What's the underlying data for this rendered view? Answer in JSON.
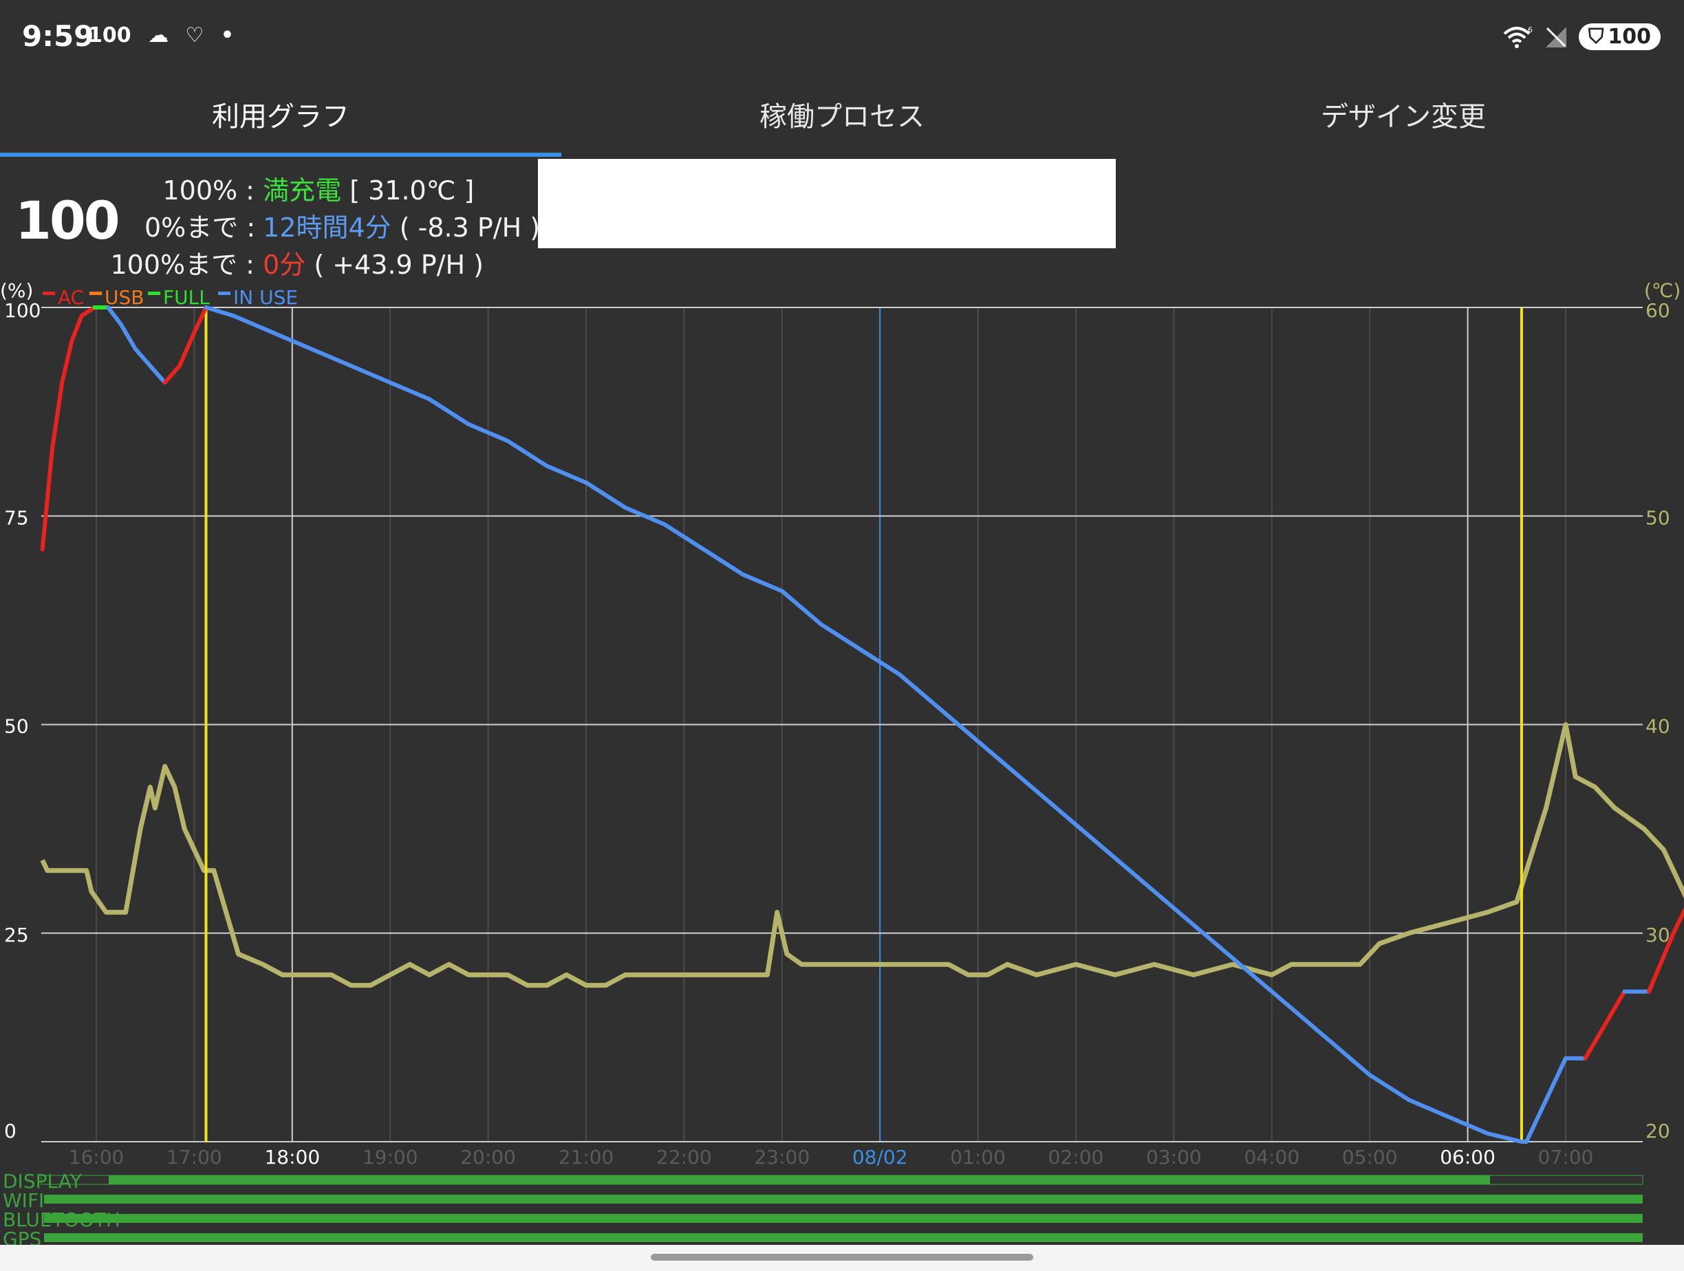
{
  "status_bar": {
    "time": "9:59",
    "left_icons": [
      {
        "name": "battery-saver-100-icon",
        "text": "100"
      },
      {
        "name": "cloud-icon",
        "text": "☁"
      },
      {
        "name": "health-icon",
        "text": "♡"
      },
      {
        "name": "dot-icon",
        "text": "•"
      }
    ],
    "right_icons": [
      "wifi-6-icon",
      "no-signal-icon"
    ],
    "battery": "100"
  },
  "tabs": [
    {
      "label": "利用グラフ",
      "active": true
    },
    {
      "label": "稼働プロセス",
      "active": false
    },
    {
      "label": "デザイン変更",
      "active": false
    }
  ],
  "info": {
    "level": "100",
    "row1": {
      "key": "100% :",
      "value": "満充電",
      "extra": "[ 31.0℃ ]"
    },
    "row2": {
      "key": "0%まで :",
      "value": "12時間4分",
      "extra": "( -8.3 P/H )"
    },
    "row3": {
      "key": "100%まで :",
      "value": "0分",
      "extra": "( +43.9 P/H )"
    }
  },
  "colors": {
    "ac": "#e8231d",
    "usb": "#f07a1f",
    "full": "#2ee02e",
    "in_use": "#4f8ff0",
    "temperature": "#b5b46a",
    "plug_marker": "#f3e21a",
    "accent": "#3b8fe6"
  },
  "chart_data": {
    "type": "line",
    "left_unit": "(%)",
    "right_unit": "(℃)",
    "left_ticks": [
      "100",
      "75",
      "50",
      "25",
      "0"
    ],
    "right_ticks": [
      "60",
      "50",
      "40",
      "30",
      "20"
    ],
    "ylim_left": [
      0,
      100
    ],
    "ylim_right": [
      20,
      60
    ],
    "x_tick_labels": [
      "16:00",
      "17:00",
      "18:00",
      "19:00",
      "20:00",
      "21:00",
      "22:00",
      "23:00",
      "08/02",
      "01:00",
      "02:00",
      "03:00",
      "04:00",
      "05:00",
      "06:00",
      "07:00"
    ],
    "legend": [
      {
        "name": "AC",
        "color": "#e8231d"
      },
      {
        "name": "USB",
        "color": "#f07a1f"
      },
      {
        "name": "FULL",
        "color": "#2ee02e"
      },
      {
        "name": "IN USE",
        "color": "#4f8ff0"
      }
    ],
    "battery_segments": [
      {
        "state": "AC",
        "points": [
          [
            15.45,
            71
          ],
          [
            15.55,
            83
          ],
          [
            15.65,
            91
          ],
          [
            15.75,
            96
          ],
          [
            15.85,
            99
          ],
          [
            15.98,
            100
          ]
        ]
      },
      {
        "state": "FULL",
        "points": [
          [
            15.98,
            100
          ],
          [
            16.12,
            100
          ]
        ]
      },
      {
        "state": "IN USE",
        "points": [
          [
            16.12,
            100
          ],
          [
            16.25,
            98
          ],
          [
            16.4,
            95
          ],
          [
            16.55,
            93
          ],
          [
            16.7,
            91
          ]
        ]
      },
      {
        "state": "AC",
        "points": [
          [
            16.7,
            91
          ],
          [
            16.85,
            93
          ],
          [
            17.0,
            97
          ],
          [
            17.12,
            100
          ]
        ]
      },
      {
        "state": "IN USE",
        "points": [
          [
            17.12,
            100
          ],
          [
            17.4,
            99
          ],
          [
            17.8,
            97
          ],
          [
            18.2,
            95
          ],
          [
            18.6,
            93
          ],
          [
            19.0,
            91
          ],
          [
            19.4,
            89
          ],
          [
            19.8,
            86
          ],
          [
            20.2,
            84
          ],
          [
            20.6,
            81
          ],
          [
            21.0,
            79
          ],
          [
            21.4,
            76
          ],
          [
            21.8,
            74
          ],
          [
            22.2,
            71
          ],
          [
            22.6,
            68
          ],
          [
            23.0,
            66
          ],
          [
            23.4,
            62
          ],
          [
            23.8,
            59
          ],
          [
            24.2,
            56
          ],
          [
            24.6,
            52
          ],
          [
            25.0,
            48
          ],
          [
            25.4,
            44
          ],
          [
            25.8,
            40
          ],
          [
            26.2,
            36
          ],
          [
            26.6,
            32
          ],
          [
            27.0,
            28
          ],
          [
            27.4,
            24
          ],
          [
            27.8,
            20
          ],
          [
            28.2,
            16
          ],
          [
            28.6,
            12
          ],
          [
            29.0,
            8
          ],
          [
            29.4,
            5
          ],
          [
            29.8,
            3
          ],
          [
            30.2,
            1
          ],
          [
            30.55,
            0
          ],
          [
            30.6,
            0
          ],
          [
            30.8,
            5
          ],
          [
            31.0,
            10
          ],
          [
            31.2,
            10
          ]
        ]
      },
      {
        "state": "AC",
        "points": [
          [
            31.2,
            10
          ],
          [
            31.6,
            18
          ]
        ]
      },
      {
        "state": "IN USE",
        "points": [
          [
            31.6,
            18
          ],
          [
            31.85,
            18
          ]
        ]
      },
      {
        "state": "AC",
        "points": [
          [
            31.85,
            18
          ],
          [
            32.1,
            25
          ],
          [
            32.35,
            31
          ],
          [
            32.6,
            38
          ],
          [
            32.8,
            46
          ],
          [
            32.95,
            54
          ]
        ]
      }
    ],
    "temperature_series": {
      "name": "Temperature",
      "points": [
        [
          15.45,
          33.5
        ],
        [
          15.5,
          33
        ],
        [
          15.9,
          33
        ],
        [
          15.95,
          32
        ],
        [
          16.1,
          31
        ],
        [
          16.3,
          31
        ],
        [
          16.45,
          35
        ],
        [
          16.55,
          37
        ],
        [
          16.6,
          36
        ],
        [
          16.7,
          38
        ],
        [
          16.8,
          37
        ],
        [
          16.9,
          35
        ],
        [
          17.0,
          34
        ],
        [
          17.1,
          33
        ],
        [
          17.2,
          33
        ],
        [
          17.45,
          29
        ],
        [
          17.7,
          28.5
        ],
        [
          17.9,
          28
        ],
        [
          18.2,
          28
        ],
        [
          18.4,
          28
        ],
        [
          18.6,
          27.5
        ],
        [
          18.8,
          27.5
        ],
        [
          19.0,
          28
        ],
        [
          19.2,
          28.5
        ],
        [
          19.4,
          28
        ],
        [
          19.6,
          28.5
        ],
        [
          19.8,
          28
        ],
        [
          20.0,
          28
        ],
        [
          20.2,
          28
        ],
        [
          20.4,
          27.5
        ],
        [
          20.6,
          27.5
        ],
        [
          20.8,
          28
        ],
        [
          21.0,
          27.5
        ],
        [
          21.2,
          27.5
        ],
        [
          21.4,
          28
        ],
        [
          21.8,
          28
        ],
        [
          22.2,
          28
        ],
        [
          22.6,
          28
        ],
        [
          22.85,
          28
        ],
        [
          22.95,
          31
        ],
        [
          23.05,
          29
        ],
        [
          23.2,
          28.5
        ],
        [
          23.6,
          28.5
        ],
        [
          24.0,
          28.5
        ],
        [
          24.4,
          28.5
        ],
        [
          24.7,
          28.5
        ],
        [
          24.9,
          28
        ],
        [
          25.1,
          28
        ],
        [
          25.3,
          28.5
        ],
        [
          25.6,
          28
        ],
        [
          26.0,
          28.5
        ],
        [
          26.4,
          28
        ],
        [
          26.8,
          28.5
        ],
        [
          27.2,
          28
        ],
        [
          27.6,
          28.5
        ],
        [
          28.0,
          28
        ],
        [
          28.2,
          28.5
        ],
        [
          28.6,
          28.5
        ],
        [
          28.9,
          28.5
        ],
        [
          29.1,
          29.5
        ],
        [
          29.4,
          30
        ],
        [
          29.8,
          30.5
        ],
        [
          30.2,
          31
        ],
        [
          30.5,
          31.5
        ],
        [
          30.8,
          36
        ],
        [
          31.0,
          40
        ],
        [
          31.1,
          37.5
        ],
        [
          31.3,
          37
        ],
        [
          31.5,
          36
        ],
        [
          31.8,
          35
        ],
        [
          32.0,
          34
        ],
        [
          32.2,
          32
        ],
        [
          32.35,
          30.5
        ],
        [
          32.5,
          30.5
        ],
        [
          32.7,
          31
        ],
        [
          32.8,
          32
        ],
        [
          32.9,
          32.5
        ],
        [
          33.0,
          32.5
        ]
      ]
    },
    "plug_markers_x": [
      17.12,
      30.55
    ],
    "usage_bars": [
      {
        "name": "DISPLAY"
      },
      {
        "name": "WIFI"
      },
      {
        "name": "BLUETOOTH"
      },
      {
        "name": "GPS"
      }
    ]
  }
}
